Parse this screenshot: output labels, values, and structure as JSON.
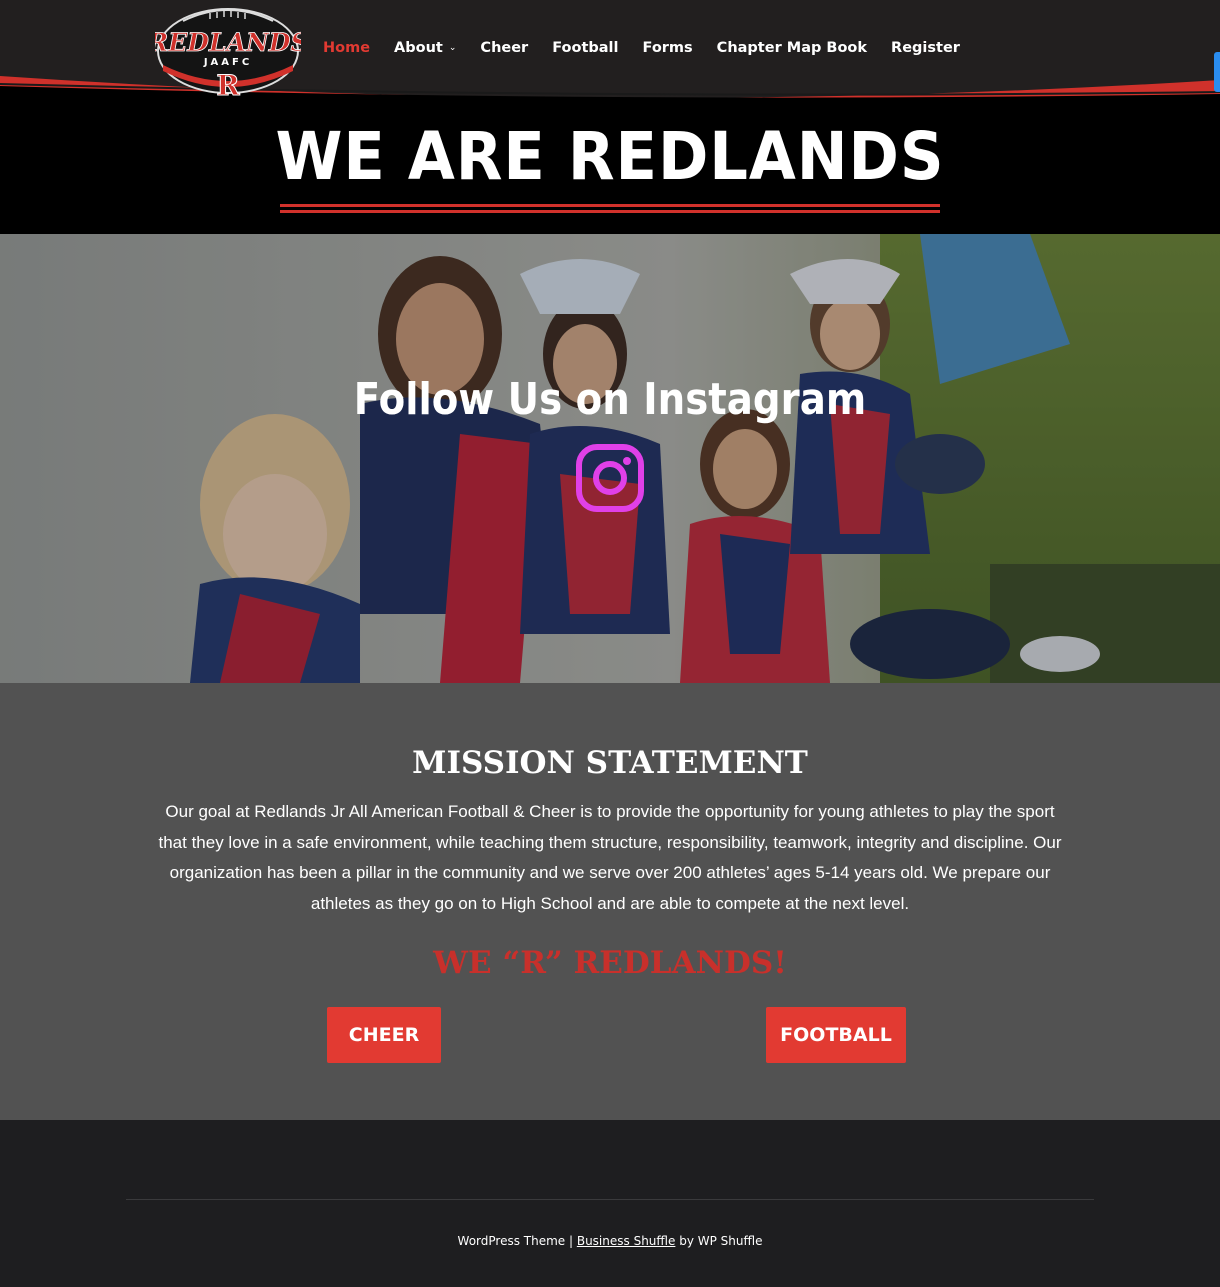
{
  "header": {
    "logo": {
      "wordmark": "REDLANDS",
      "sub": "JAAFC",
      "letter": "R"
    },
    "nav": [
      {
        "label": "Home",
        "active": true
      },
      {
        "label": "About",
        "has_dropdown": true
      },
      {
        "label": "Cheer"
      },
      {
        "label": "Football"
      },
      {
        "label": "Forms"
      },
      {
        "label": "Chapter Map Book"
      },
      {
        "label": "Register"
      }
    ]
  },
  "banner": {
    "title": "WE ARE REDLANDS"
  },
  "hero": {
    "heading": "Follow Us on Instagram",
    "icon": "instagram-icon"
  },
  "mission": {
    "title": "MISSION STATEMENT",
    "body": "Our goal at Redlands Jr All American Football & Cheer is to provide the opportunity for young athletes to play the sport that they love in a safe environment, while teaching them structure, responsibility, teamwork, integrity and discipline. Our organization has been a pillar in the community and we serve over 200 athletes’ ages 5-14 years old. We prepare our athletes as they go on to High School and are able to compete at the next level.",
    "tagline": "WE “R” REDLANDS!",
    "buttons": {
      "cheer": "CHEER",
      "football": "FOOTBALL"
    }
  },
  "footer": {
    "prefix": "WordPress Theme | ",
    "theme_link": "Business Shuffle",
    "suffix": " by WP Shuffle"
  },
  "colors": {
    "accent_red": "#e23a32",
    "header_bg": "#221f1f",
    "mission_bg": "#525252",
    "footer_bg": "#1e1e20",
    "instagram": "#e040e8"
  }
}
